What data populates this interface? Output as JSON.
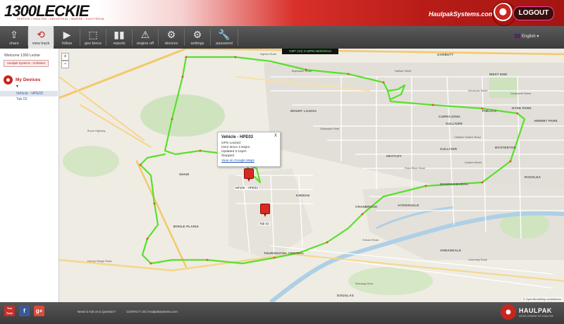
{
  "header": {
    "logo_text": "1300LECKIE",
    "logo_tagline": "SERVICE • HAULPAK • INDUSTRIAL • MARINE • ELECTRICAL",
    "site_link": "HaulpakSystems.com",
    "logout_label": "LOGOUT",
    "accent_color": "#c8251f"
  },
  "toolbar": {
    "buttons": [
      {
        "label": "share",
        "icon": "share-icon"
      },
      {
        "label": "view track",
        "icon": "refresh-icon",
        "active": true
      },
      {
        "label": "follow",
        "icon": "play-icon"
      },
      {
        "label": "geo fence",
        "icon": "geofence-icon"
      },
      {
        "label": "reports",
        "icon": "bar-chart-icon"
      },
      {
        "label": "engine off",
        "icon": "warning-icon"
      },
      {
        "label": "devices",
        "icon": "gears-icon"
      },
      {
        "label": "settings",
        "icon": "gears-icon"
      },
      {
        "label": "password",
        "icon": "wrench-icon"
      }
    ],
    "language": "English ▾"
  },
  "sidebar": {
    "welcome": "Welcome 1300 Leckie",
    "account": "Haulpak Systems - Unlimited",
    "section_title": "My Devices",
    "devices": [
      {
        "name": "Vehicle - HPE03",
        "selected": true
      },
      {
        "name": "Tab 02",
        "selected": false
      }
    ]
  },
  "map": {
    "zoom_in": "+",
    "zoom_out": "−",
    "gps_bar": "GMT (10) 2:15PM 06/02/2014",
    "popup": {
      "title": "Vehicle - HPE03",
      "close": "X",
      "lines": [
        "GPS Locked",
        "Here since 1:54pm",
        "Updated 2:14pm",
        "Stopped"
      ],
      "link": "View on Google Maps"
    },
    "markers": [
      {
        "label": "Vehicle - HPE03"
      },
      {
        "label": "Tab 02"
      }
    ],
    "suburbs": [
      "GARBUTT",
      "WEST END",
      "HYDE PARK",
      "HERMIT PARK",
      "MOUNT LOUISA",
      "CURRAJONG",
      "PIMLICO",
      "SULLIVER",
      "MYSTERTON",
      "HEATLEY",
      "ROSSLEA",
      "GULLIVER",
      "KIRWAN",
      "CRANBROOK",
      "AITKENVALE",
      "MUNDINGBURRA",
      "SHAW",
      "BOHLE PLAINS",
      "THURINGOWA CENTRAL",
      "ANNANDALE",
      "DOUGLAS"
    ],
    "streets": [
      "Ingham Road",
      "Bayswater Road",
      "Nathan Street",
      "Woolcock Street",
      "University Road",
      "Hervey Range Road",
      "Gulliver Street",
      "Ross River Road",
      "Charters Towers Road",
      "Riverway Drive",
      "Dalrymple Road",
      "Duckworth Street",
      "Fulham Road",
      "Bruce Highway"
    ],
    "attribution": "© OpenStreetMap contributors",
    "track_color": "#59e02a"
  },
  "footer": {
    "social": [
      {
        "label": "You Tube",
        "color": "#c4302b"
      },
      {
        "label": "f",
        "color": "#3b5998"
      },
      {
        "label": "g+",
        "color": "#dd4b39"
      }
    ],
    "links": [
      "Need to Ask Us a Question?",
      "CONTACT US | HaulpakSystems.com"
    ],
    "brand": "HAULPAK",
    "brand_sub": "SYSTEMS",
    "brand_note": "DEVELOPMENT BY HAULPAK"
  }
}
